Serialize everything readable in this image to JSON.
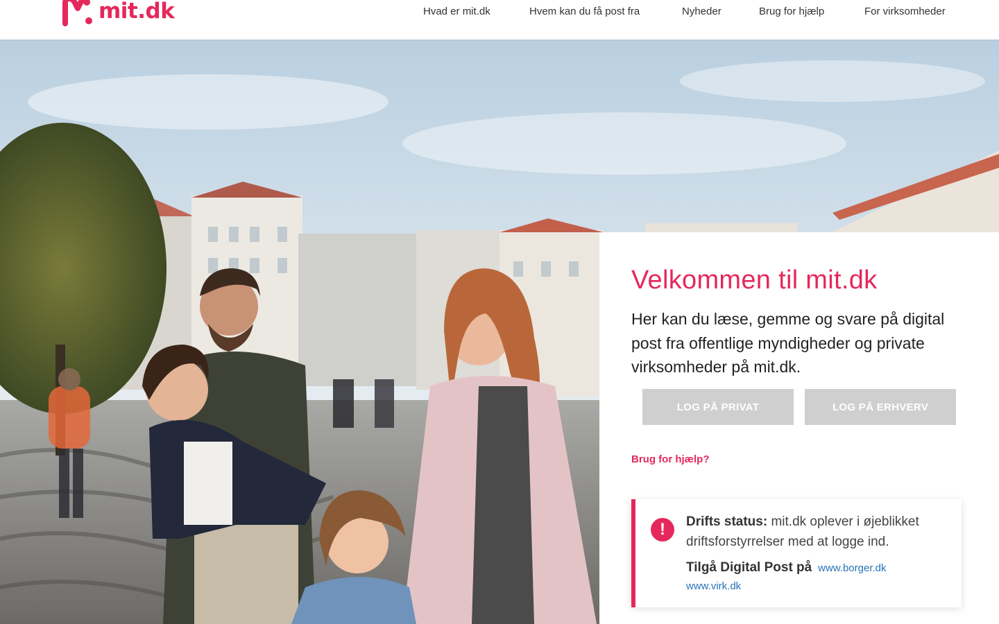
{
  "brand": {
    "logo_text": "mit.dk",
    "accent": "#e5285c"
  },
  "nav": {
    "items": [
      {
        "label": "Hvad er mit.dk"
      },
      {
        "label": "Hvem kan du få post fra"
      },
      {
        "label": "Nyheder"
      },
      {
        "label": "Brug for hjælp"
      },
      {
        "label": "For virksomheder"
      }
    ]
  },
  "hero": {
    "image": "family-walking-in-city-square-photo"
  },
  "welcome": {
    "title": "Velkommen til mit.dk",
    "text": "Her kan du læse, gemme og svare på digital post fra offentlige myndigheder og private virksomheder på mit.dk.",
    "login_private": "LOG PÅ PRIVAT",
    "login_business": "LOG PÅ ERHVERV",
    "help_link": "Brug for hjælp?"
  },
  "status": {
    "icon": "exclamation-icon",
    "label": "Drifts status:",
    "message": "mit.dk oplever i øjeblikket driftsforstyrrelser med at logge ind.",
    "access_label": "Tilgå Digital Post på",
    "link_borger": "www.borger.dk",
    "link_virk": "www.virk.dk"
  }
}
